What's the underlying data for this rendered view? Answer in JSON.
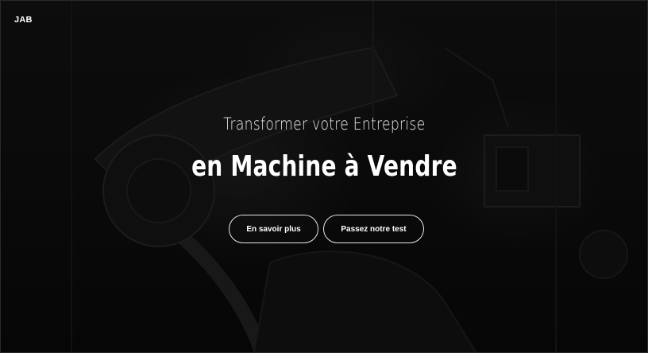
{
  "header": {
    "brand": "JAB"
  },
  "hero": {
    "subtitle": "Transformer votre Entreprise",
    "title": "en Machine à Vendre",
    "buttons": {
      "learn_more": "En savoir plus",
      "take_test": "Passez notre test"
    }
  },
  "colors": {
    "text": "#ffffff",
    "background": "#0b0b0b",
    "button_border": "#e6e6e6"
  }
}
